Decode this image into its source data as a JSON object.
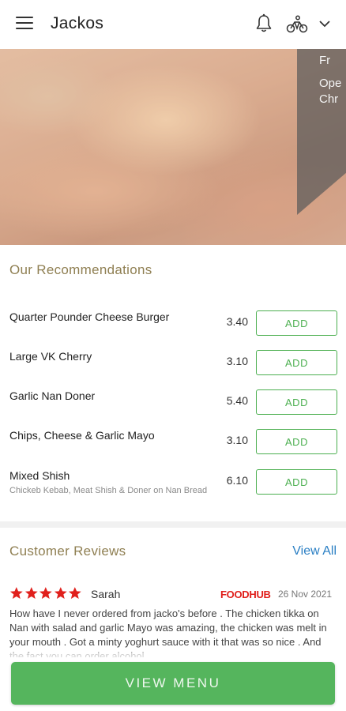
{
  "header": {
    "title": "Jackos"
  },
  "hero": {
    "panel_line1": "Fr",
    "panel_line2": "Ope",
    "panel_line3": "Chr"
  },
  "recommendations": {
    "title": "Our Recommendations",
    "add_label": "ADD",
    "items": [
      {
        "name": "Quarter Pounder Cheese Burger",
        "description": "",
        "price": "3.40"
      },
      {
        "name": "Large VK Cherry",
        "description": "",
        "price": "3.10"
      },
      {
        "name": "Garlic Nan Doner",
        "description": "",
        "price": "5.40"
      },
      {
        "name": "Chips, Cheese & Garlic Mayo",
        "description": "",
        "price": "3.10"
      },
      {
        "name": "Mixed Shish",
        "description": "Chickeb Kebab, Meat Shish & Doner on Nan Bread",
        "price": "6.10"
      }
    ]
  },
  "reviews": {
    "title": "Customer Reviews",
    "view_all": "View All",
    "items": [
      {
        "rating": 5,
        "reviewer": "Sarah",
        "source": "FOODHUB",
        "date": "26 Nov 2021",
        "text": "How have I never ordered from jacko's before . The chicken tikka on Nan with salad and garlic Mayo was amazing, the chicken was melt in your mouth . Got a minty yoghurt sauce with it that was so nice . And the fact you can order alcohol"
      }
    ]
  },
  "footer": {
    "view_menu": "VIEW MENU"
  },
  "colors": {
    "accent_green": "#55b55d",
    "section_title": "#8f7f52",
    "link_blue": "#2a7fc4",
    "star_red": "#e0201c"
  }
}
